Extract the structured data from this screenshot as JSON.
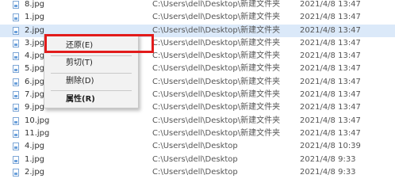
{
  "rows": [
    {
      "name": "8.jpg",
      "path": "C:\\Users\\dell\\Desktop\\新建文件夹",
      "date": "2021/4/8 13:47"
    },
    {
      "name": "1.jpg",
      "path": "C:\\Users\\dell\\Desktop\\新建文件夹",
      "date": "2021/4/8 13:47"
    },
    {
      "name": "2.jpg",
      "path": "C:\\Users\\dell\\Desktop\\新建文件夹",
      "date": "2021/4/8 13:47"
    },
    {
      "name": "3.jpg",
      "path": "C:\\Users\\dell\\Desktop\\新建文件夹",
      "date": "2021/4/8 13:47"
    },
    {
      "name": "4.jpg",
      "path": "C:\\Users\\dell\\Desktop\\新建文件夹",
      "date": "2021/4/8 13:47"
    },
    {
      "name": "5.jpg",
      "path": "C:\\Users\\dell\\Desktop\\新建文件夹",
      "date": "2021/4/8 13:47"
    },
    {
      "name": "6.jpg",
      "path": "C:\\Users\\dell\\Desktop\\新建文件夹",
      "date": "2021/4/8 13:47"
    },
    {
      "name": "7.jpg",
      "path": "C:\\Users\\dell\\Desktop\\新建文件夹",
      "date": "2021/4/8 13:47"
    },
    {
      "name": "9.jpg",
      "path": "C:\\Users\\dell\\Desktop\\新建文件夹",
      "date": "2021/4/8 13:47"
    },
    {
      "name": "10.jpg",
      "path": "C:\\Users\\dell\\Desktop\\新建文件夹",
      "date": "2021/4/8 13:47"
    },
    {
      "name": "11.jpg",
      "path": "C:\\Users\\dell\\Desktop\\新建文件夹",
      "date": "2021/4/8 13:47"
    },
    {
      "name": "4.jpg",
      "path": "C:\\Users\\dell\\Desktop",
      "date": "2021/4/8 10:39"
    },
    {
      "name": "1.jpg",
      "path": "C:\\Users\\dell\\Desktop",
      "date": "2021/4/8 9:33"
    },
    {
      "name": "2.jpg",
      "path": "C:\\Users\\dell\\Desktop",
      "date": "2021/4/8 9:33"
    }
  ],
  "selected_row": 2,
  "context_menu": {
    "items": [
      {
        "label": "还原(E)"
      },
      {
        "label": "剪切(T)"
      },
      {
        "label": "删除(D)"
      },
      {
        "label": "属性(R)"
      }
    ]
  },
  "colors": {
    "selection": "#dbe9f9",
    "highlight_border": "#e21b1b",
    "menu_background": "#f2f2f2"
  },
  "icons": {
    "file": "jpg-file-icon"
  }
}
